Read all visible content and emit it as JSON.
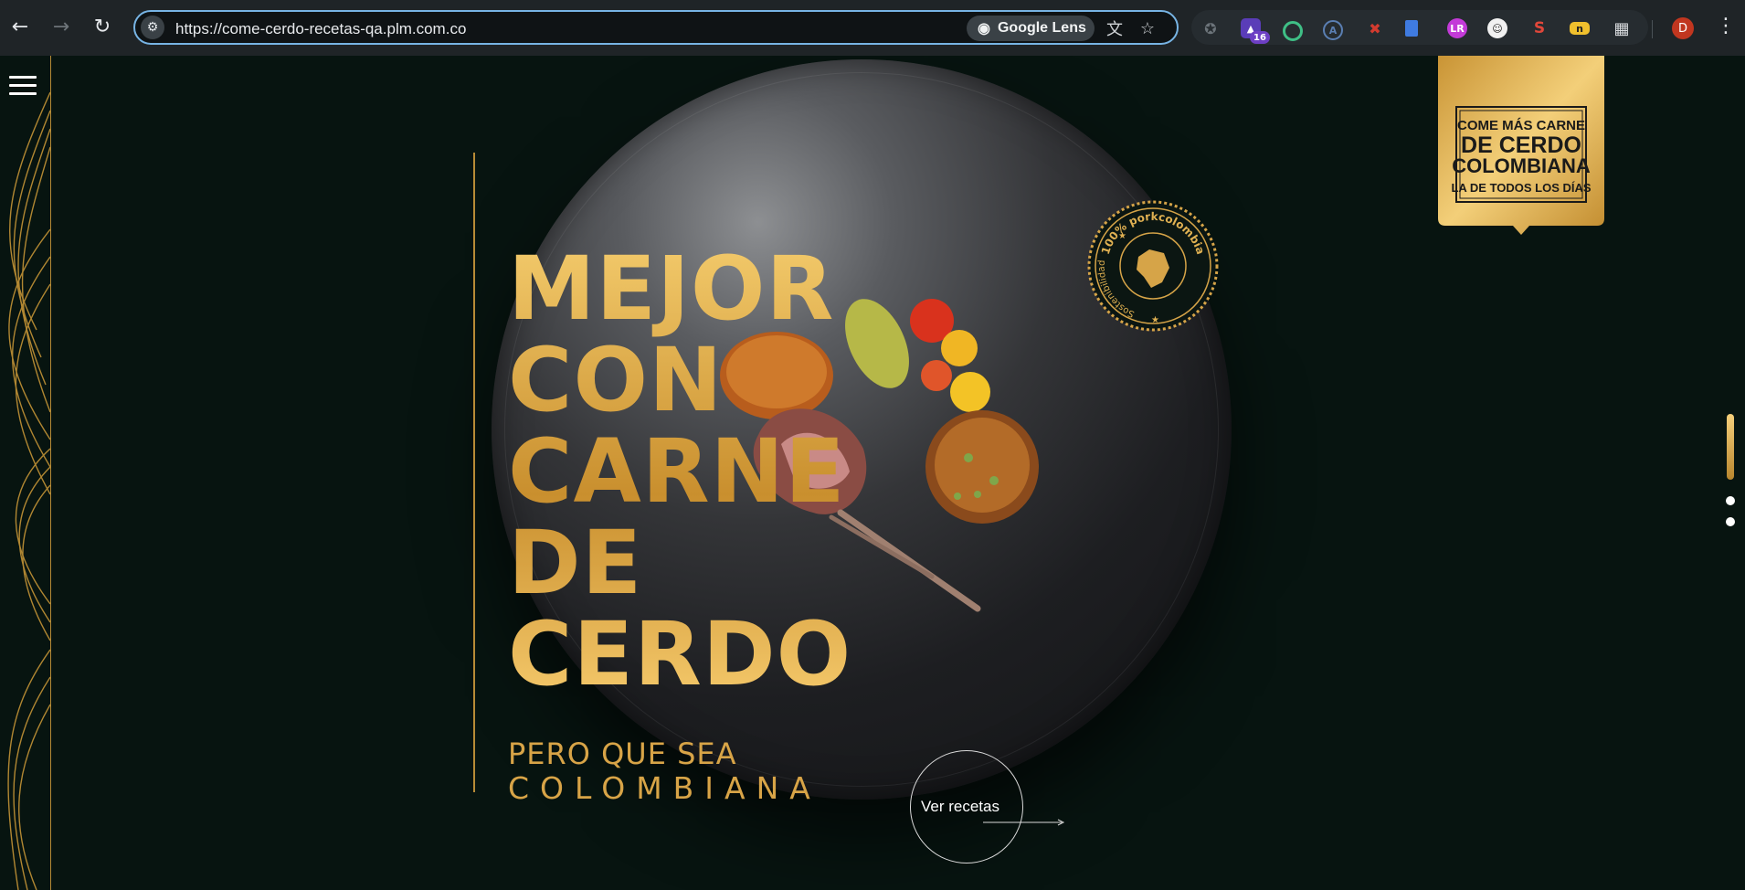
{
  "browser": {
    "url": "https://come-cerdo-recetas-qa.plm.com.co",
    "lens_label": "Google Lens",
    "extension_badge": "16",
    "profile_initial": "D"
  },
  "hero": {
    "headline_lines": [
      "MEJOR",
      "CON",
      "CARNE",
      "DE",
      "CERDO"
    ],
    "sub_line1": "PERO QUE SEA",
    "sub_line2": "COLOMBIANA",
    "cta_label": "Ver recetas"
  },
  "seal": {
    "top_text": "100% porkcolombia",
    "left_text": "Sostenibilidad"
  },
  "logo": {
    "line1": "COME MÁS CARNE",
    "line2": "DE CERDO",
    "line3": "COLOMBIANA",
    "line4": "LA DE TODOS LOS DÍAS"
  },
  "colors": {
    "page_background": "#071410",
    "gold": "#d8a447",
    "gold_light": "#f2c96a",
    "omnibox_focus": "#77b4e4",
    "profile_red": "#c1361f"
  },
  "slider": {
    "slides": 3,
    "active_index": 0
  }
}
